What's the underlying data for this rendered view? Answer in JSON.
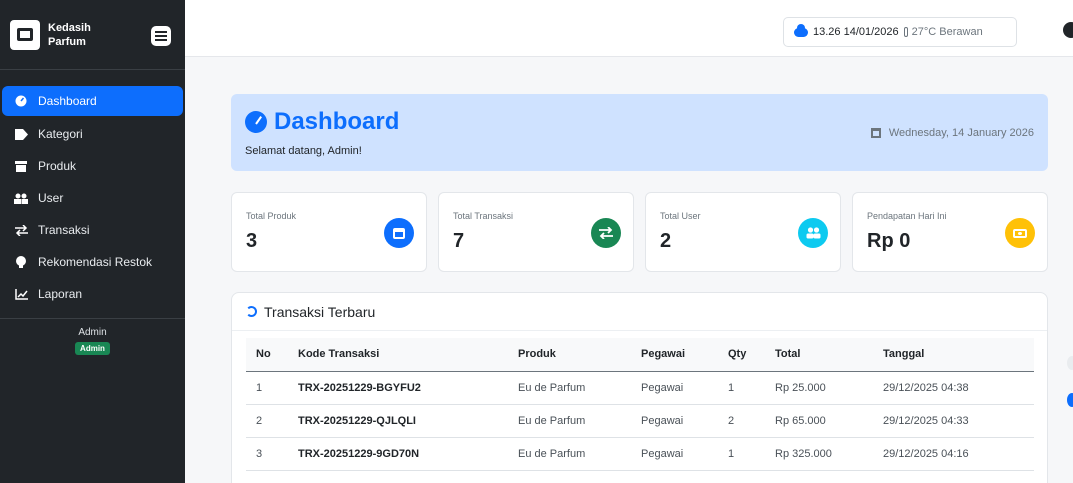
{
  "sidebar": {
    "brand": "Kedasih Parfum",
    "items": [
      {
        "label": "Dashboard",
        "icon": "gauge-icon",
        "active": true
      },
      {
        "label": "Kategori",
        "icon": "tag-icon"
      },
      {
        "label": "Produk",
        "icon": "box-icon"
      },
      {
        "label": "User",
        "icon": "users-icon"
      },
      {
        "label": "Transaksi",
        "icon": "exchange-icon"
      },
      {
        "label": "Rekomendasi Restok",
        "icon": "lightbulb-icon"
      },
      {
        "label": "Laporan",
        "icon": "chart-icon"
      }
    ],
    "user_name": "Admin",
    "user_role": "Admin"
  },
  "topbar": {
    "datetime": "13.26 14/01/2026",
    "weather": "27°C Berawan"
  },
  "header": {
    "title": "Dashboard",
    "subtitle": "Selamat datang, Admin!",
    "date": "Wednesday, 14 January 2026"
  },
  "stats": [
    {
      "label": "Total Produk",
      "value": "3",
      "color": "#0d6efd",
      "icon": "box-icon"
    },
    {
      "label": "Total Transaksi",
      "value": "7",
      "color": "#198754",
      "icon": "exchange-icon"
    },
    {
      "label": "Total User",
      "value": "2",
      "color": "#0dcaf0",
      "icon": "users-icon"
    },
    {
      "label": "Pendapatan Hari Ini",
      "value": "Rp 0",
      "color": "#ffc107",
      "icon": "cash-icon"
    }
  ],
  "transactions": {
    "title": "Transaksi Terbaru",
    "columns": [
      "No",
      "Kode Transaksi",
      "Produk",
      "Pegawai",
      "Qty",
      "Total",
      "Tanggal"
    ],
    "rows": [
      [
        "1",
        "TRX-20251229-BGYFU2",
        "Eu de Parfum",
        "Pegawai",
        "1",
        "Rp 25.000",
        "29/12/2025 04:38"
      ],
      [
        "2",
        "TRX-20251229-QJLQLI",
        "Eu de Parfum",
        "Pegawai",
        "2",
        "Rp 65.000",
        "29/12/2025 04:33"
      ],
      [
        "3",
        "TRX-20251229-9GD70N",
        "Eu de Parfum",
        "Pegawai",
        "1",
        "Rp 325.000",
        "29/12/2025 04:16"
      ]
    ]
  },
  "colors": {
    "primary": "#0d6efd",
    "sidebar_bg": "#212529",
    "header_bg": "#cfe2ff",
    "success": "#198754"
  }
}
